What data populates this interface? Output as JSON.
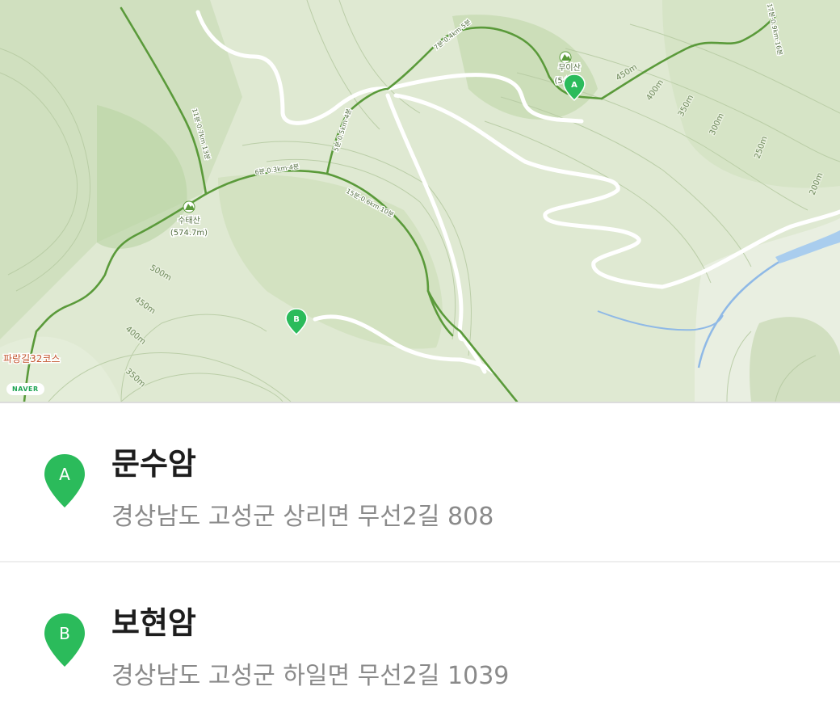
{
  "map": {
    "badge": "NAVER",
    "peaks": [
      {
        "name": "수태산",
        "elevation": "(574.7m)"
      },
      {
        "name": "무이산",
        "elevation": "(545"
      }
    ],
    "trail_name": "파랑길32코스",
    "trail_times": [
      "7분·0.4km·5분",
      "5분·0.5km·4분",
      "6분·0.3km·4분",
      "15분·0.6km·10분",
      "11분·0.7km·13분",
      "17분·0.9km·16분"
    ],
    "contours": [
      "500m",
      "450m",
      "400m",
      "350m",
      "450m",
      "400m",
      "350m",
      "300m",
      "250m",
      "200m"
    ],
    "markers": [
      "A",
      "B"
    ],
    "colors": {
      "land": "#dfe9d2",
      "ridge_trail": "#5a9a3a",
      "marker": "#2bbb5b",
      "water": "#8fb9e6"
    }
  },
  "places": [
    {
      "marker": "A",
      "name": "문수암",
      "address": "경상남도 고성군 상리면 무선2길 808"
    },
    {
      "marker": "B",
      "name": "보현암",
      "address": "경상남도 고성군 하일면 무선2길 1039"
    }
  ]
}
